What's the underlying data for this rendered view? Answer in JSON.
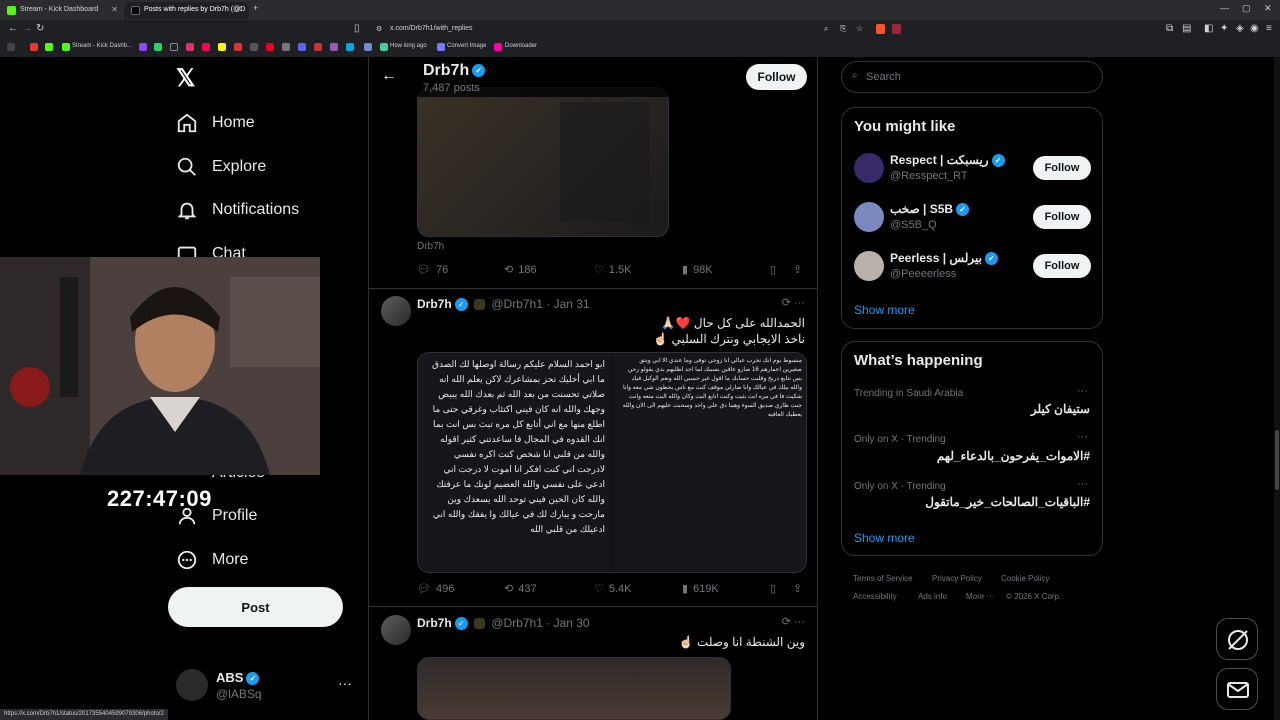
{
  "browser": {
    "tabs": [
      {
        "title": "Stream - Kick Dashboard",
        "active": false
      },
      {
        "title": "Posts with replies by Drb7h (@D",
        "active": true
      }
    ],
    "url": "x.com/Drb7h1/with_replies",
    "new_tab": "+",
    "bookmarks": [
      "Stream - Kick Dashb...",
      "How long ago",
      "Convert Image",
      "Downloader"
    ],
    "status_url": "https://x.com/Drb7h1/status/2017355404599079306/photo/2"
  },
  "nav": {
    "home": "Home",
    "explore": "Explore",
    "notifications": "Notifications",
    "chat": "Chat",
    "articles": "Articles",
    "profile": "Profile",
    "more": "More",
    "post": "Post",
    "account": {
      "name": "ABS",
      "handle": "@lABSq"
    }
  },
  "overlay": {
    "timer": "227:47:09"
  },
  "header": {
    "name": "Drb7h",
    "posts": "7,487 posts",
    "follow": "Follow"
  },
  "tweets": [
    {
      "caption": "Drb7h",
      "stats": {
        "replies": "76",
        "reposts": "186",
        "likes": "1.5K",
        "views": "98K"
      }
    },
    {
      "name": "Drb7h",
      "handle": "@Drb7h1",
      "date": "Jan 31",
      "line1": "الحمدالله على كل حال ❤️🙏🏻",
      "line2": "ناخذ الايجابي ونترك السلبي ☝🏻",
      "img_left": "ابو احمد السلام عليكم رسالة اوصلها لك الصدق ما ابي أخليك تحز بمشاعرك لاكن يعلم الله انه صلاتي تحسنت من بعد الله ثم بعدك الله يبيض وجهك والله انه كان فيني اكتئاب وغرقي حتى ما اطلع منها مع اني أتابع كل مره تبث بس انت بما انك القدوه في المجال فا ساعدتني كثير اقوله والله من قلبي انا شخص كنت اكره نفسي لادرجت اني كنت افكر انا اموت لا درجت اني ادعي على نفسي والله العضيم لونك ما عرفتك والله كان الحين فيني توحد الله يسعدك وين مارحت و يبارك لك في عيالك وا يفقك والله اني ادعيلك من قلبي الله",
      "img_right": "مبسوط يوم انك تخرب عيالي انا زوجي توفى وما عندي الا ابي وبتق صغيرين اعمارهم 16 صارو عاقين بسببك لما احد اطلبهم بدي يقولو رحن بس تتابع دريخ وقلبت حسابك ما اقول غير حسبي الله ونعم الوكيل فيك والله بيلك في عيالك وانا صارلي موقف كنت مع ناس يحطون شي معه وانا شكيت فا في مره انت بثيت وكنت اتابع البث وكان والله البث متعه وانت جبت طاري صديق السوء وهينا دق علي واحد وسحبت عليهم الى الان والله يعطيك العافيه",
      "stats": {
        "replies": "496",
        "reposts": "437",
        "likes": "5.4K",
        "views": "619K"
      }
    },
    {
      "name": "Drb7h",
      "handle": "@Drb7h1",
      "date": "Jan 30",
      "line1": "وين الشنطة انا وصلت ☝🏻"
    }
  ],
  "right": {
    "search_placeholder": "Search",
    "might_like_title": "You might like",
    "suggestions": [
      {
        "name": "Respect | ريسبكت",
        "handle": "@Resspect_RT",
        "follow": "Follow"
      },
      {
        "name": "صخب | S5B",
        "handle": "@S5B_Q",
        "follow": "Follow"
      },
      {
        "name": "Peerless | بيرلس",
        "handle": "@Peeeerless",
        "follow": "Follow"
      }
    ],
    "show_more": "Show more",
    "happening_title": "What’s happening",
    "trends": [
      {
        "meta": "Trending in Saudi Arabia",
        "name": "ستيفان كيلر"
      },
      {
        "meta": "Only on X · Trending",
        "name": "#الاموات_يفرحون_بالدعاء_لهم"
      },
      {
        "meta": "Only on X · Trending",
        "name": "#الباقيات_الصالحات_خير_ماتقول"
      }
    ],
    "show_more2": "Show more",
    "footer": [
      "Terms of Service",
      "Privacy Policy",
      "Cookie Policy",
      "Accessibility",
      "Ads info",
      "More ···",
      "© 2026 X Corp."
    ]
  },
  "colors": {
    "accent": "#1d9bf0",
    "bg": "#000000",
    "border": "#2f3336",
    "muted": "#71767b"
  }
}
